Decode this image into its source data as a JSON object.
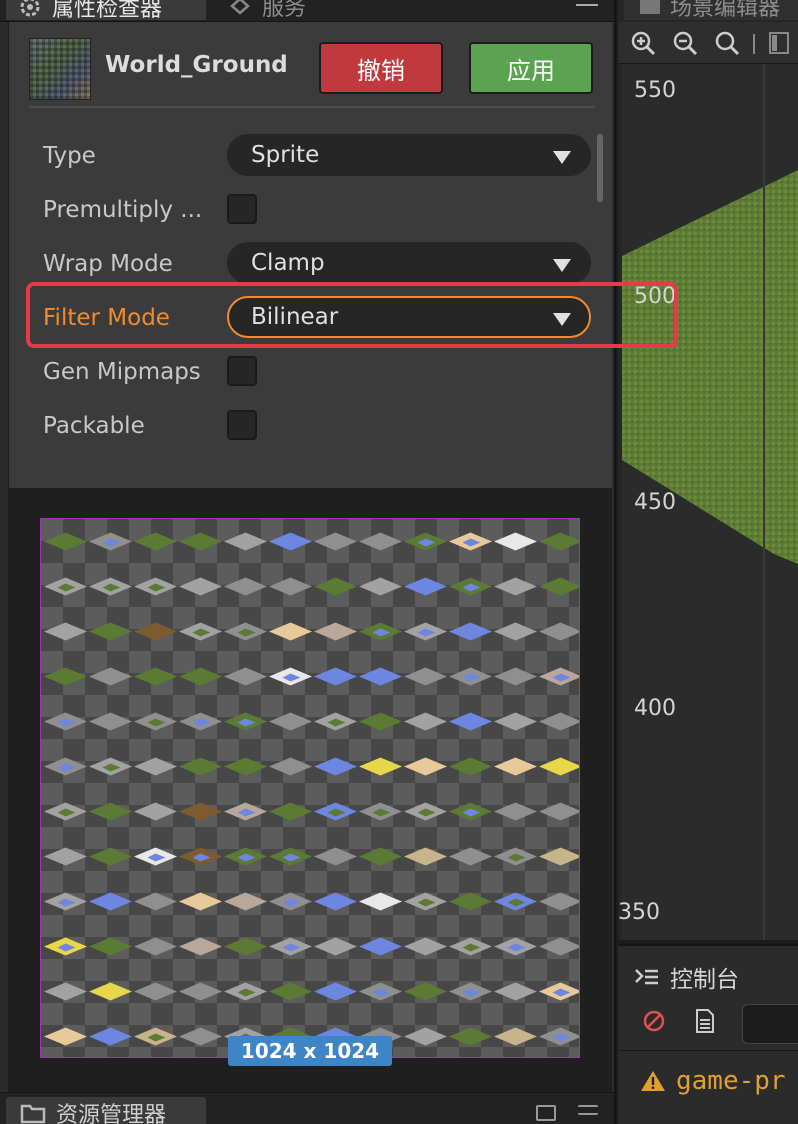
{
  "inspector": {
    "tab_label": "属性检查器",
    "asset_name": "World_Ground",
    "revert_label": "撤销",
    "apply_label": "应用",
    "properties": [
      {
        "label": "Type",
        "kind": "select",
        "value": "Sprite"
      },
      {
        "label": "Premultiply ...",
        "kind": "checkbox",
        "checked": false
      },
      {
        "label": "Wrap Mode",
        "kind": "select",
        "value": "Clamp"
      },
      {
        "label": "Filter Mode",
        "kind": "select",
        "value": "Bilinear",
        "highlighted": true
      },
      {
        "label": "Gen Mipmaps",
        "kind": "checkbox",
        "checked": false
      },
      {
        "label": "Packable",
        "kind": "checkbox",
        "checked": false
      }
    ],
    "preview_size": "1024 x 1024"
  },
  "services_tab_label": "服务",
  "assets_tab_label": "资源管理器",
  "scene": {
    "tab_label": "场景编辑器",
    "axis_labels": [
      "550",
      "500",
      "450",
      "400",
      "350"
    ]
  },
  "console": {
    "title": "控制台",
    "log_text": "game-pr"
  },
  "colors": {
    "accent_orange": "#f08c2e",
    "revert_red": "#c0393f",
    "apply_green": "#5ba350",
    "size_badge_blue": "#3e85c6",
    "annotation_red": "#e8394a"
  }
}
